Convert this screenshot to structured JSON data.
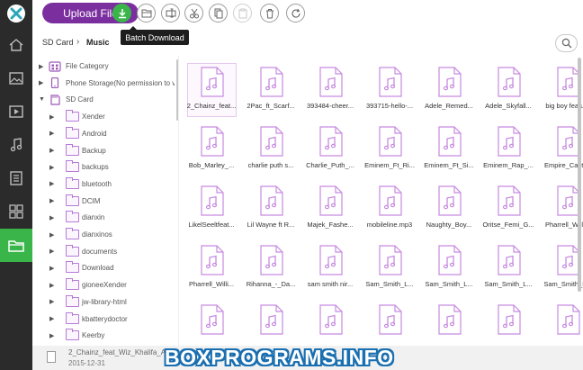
{
  "app": {
    "logo_icon": "xender-logo-icon",
    "accent_color": "#7b2f9f",
    "active_color": "#3ab54a"
  },
  "rail": {
    "items": [
      {
        "icon": "home-icon",
        "active": false
      },
      {
        "icon": "image-icon",
        "active": false
      },
      {
        "icon": "video-icon",
        "active": false
      },
      {
        "icon": "music-icon",
        "active": false
      },
      {
        "icon": "document-icon",
        "active": false
      },
      {
        "icon": "apps-icon",
        "active": false
      },
      {
        "icon": "folder-icon",
        "active": true
      }
    ]
  },
  "toolbar": {
    "upload_label": "Upload File",
    "tools": [
      "download-icon",
      "new-folder-icon",
      "rename-icon",
      "cut-icon",
      "copy-icon",
      "paste-icon",
      "delete-icon",
      "refresh-icon"
    ],
    "tooltip": "Batch Download"
  },
  "breadcrumb": {
    "root": "SD Card",
    "separator": "›",
    "current": "Music"
  },
  "tree": [
    {
      "label": "File Category",
      "level": 0,
      "expanded": false,
      "icon": "category-icon"
    },
    {
      "label": "Phone Storage(No permission to v",
      "level": 0,
      "expanded": false,
      "icon": "phone-icon"
    },
    {
      "label": "SD Card",
      "level": 0,
      "expanded": true,
      "icon": "sdcard-icon"
    },
    {
      "label": "Xender",
      "level": 1,
      "expanded": false,
      "icon": "folder-icon"
    },
    {
      "label": "Android",
      "level": 1,
      "expanded": false,
      "icon": "folder-icon"
    },
    {
      "label": "Backup",
      "level": 1,
      "expanded": false,
      "icon": "folder-icon"
    },
    {
      "label": "backups",
      "level": 1,
      "expanded": false,
      "icon": "folder-icon"
    },
    {
      "label": "bluetooth",
      "level": 1,
      "expanded": false,
      "icon": "folder-icon"
    },
    {
      "label": "DCIM",
      "level": 1,
      "expanded": false,
      "icon": "folder-icon"
    },
    {
      "label": "dianxin",
      "level": 1,
      "expanded": false,
      "icon": "folder-icon"
    },
    {
      "label": "dianxinos",
      "level": 1,
      "expanded": false,
      "icon": "folder-icon"
    },
    {
      "label": "documents",
      "level": 1,
      "expanded": false,
      "icon": "folder-icon"
    },
    {
      "label": "Download",
      "level": 1,
      "expanded": false,
      "icon": "folder-icon"
    },
    {
      "label": "gioneeXender",
      "level": 1,
      "expanded": false,
      "icon": "folder-icon"
    },
    {
      "label": "jw-library-html",
      "level": 1,
      "expanded": false,
      "icon": "folder-icon"
    },
    {
      "label": "kbatterydoctor",
      "level": 1,
      "expanded": false,
      "icon": "folder-icon"
    },
    {
      "label": "Keerby",
      "level": 1,
      "expanded": false,
      "icon": "folder-icon"
    }
  ],
  "files": [
    [
      "2_Chainz_feat...",
      "2Pac_ft_Scarf...",
      "393484-cheer...",
      "393715-hello-...",
      "Adele_Remed...",
      "Adele_Skyfall...",
      "big boy featu..."
    ],
    [
      "Bob_Marley_...",
      "charlie puth s...",
      "Charlie_Puth_...",
      "Eminem_Ft_Ri...",
      "Eminem_Ft_Si...",
      "Eminem_Rap_...",
      "Empire_Cast-..."
    ],
    [
      "LikelSeeltfeat...",
      "Lil Wayne ft R...",
      "Majek_Fashe...",
      "mobileline.mp3",
      "Naughty_Boy...",
      "Oritse_Femi_G...",
      "Pharrell_Willi..."
    ],
    [
      "Pharrell_Willi...",
      "Rihanna_-_Da...",
      "sam smith nir...",
      "Sam_Smith_L...",
      "Sam_Smith_L...",
      "Sam_Smith_L...",
      "Sam_Smith_L..."
    ],
    [
      "",
      "",
      "",
      "",
      "",
      "",
      ""
    ]
  ],
  "file_icon": "music-file-icon",
  "selected_file": "2_Chainz_feat...",
  "status": {
    "name": "2_Chainz_feat_Wiz_Khalifa_A_",
    "date": "2015-12-31"
  },
  "watermark": "BOXPROGRAMS.INFO"
}
